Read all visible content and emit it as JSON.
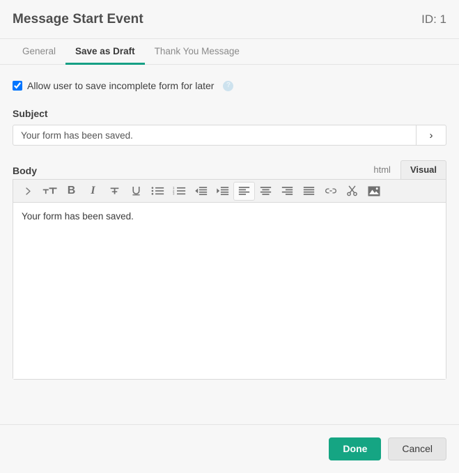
{
  "header": {
    "title": "Message Start Event",
    "id_label": "ID: 1"
  },
  "tabs": [
    {
      "label": "General",
      "active": false
    },
    {
      "label": "Save as Draft",
      "active": true
    },
    {
      "label": "Thank You Message",
      "active": false
    }
  ],
  "form": {
    "allow_save_checkbox": {
      "label": "Allow user to save incomplete form for later",
      "checked": true,
      "help_glyph": "?"
    },
    "subject": {
      "label": "Subject",
      "value": "Your form has been saved.",
      "placeholder": "",
      "expand_glyph": "›"
    },
    "body": {
      "label": "Body",
      "value": "Your form has been saved.",
      "modes": [
        {
          "label": "html",
          "active": false
        },
        {
          "label": "Visual",
          "active": true
        }
      ],
      "toolbar": [
        {
          "name": "expand-toolbar-icon",
          "glyph": "›"
        },
        {
          "name": "font-size-icon"
        },
        {
          "name": "bold-icon",
          "glyph": "B"
        },
        {
          "name": "italic-icon",
          "glyph": "I"
        },
        {
          "name": "strikethrough-icon"
        },
        {
          "name": "underline-icon",
          "glyph": "U"
        },
        {
          "name": "bullet-list-icon"
        },
        {
          "name": "numbered-list-icon"
        },
        {
          "name": "outdent-icon"
        },
        {
          "name": "indent-icon"
        },
        {
          "name": "align-left-icon",
          "active": true
        },
        {
          "name": "align-center-icon"
        },
        {
          "name": "align-right-icon"
        },
        {
          "name": "align-justify-icon"
        },
        {
          "name": "link-icon"
        },
        {
          "name": "cut-icon"
        },
        {
          "name": "image-icon"
        }
      ]
    }
  },
  "footer": {
    "done_label": "Done",
    "cancel_label": "Cancel"
  },
  "colors": {
    "accent": "#16a085",
    "done_button": "#15a583",
    "help_icon": "#cde2ee",
    "page_background": "#f7f7f7"
  }
}
